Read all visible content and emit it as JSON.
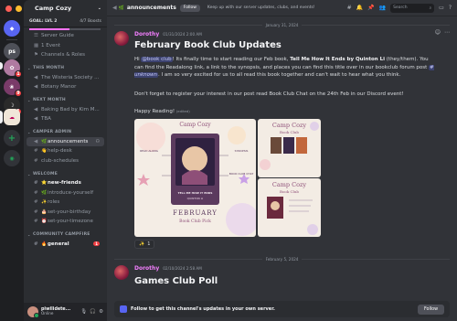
{
  "server": {
    "name": "Camp Cozy",
    "boost_level": "GOAL: LVL 2",
    "boost_count": "4/7 Boosts",
    "boost_progress": 0.57
  },
  "sidebar": {
    "top_items": [
      {
        "icon": "☰",
        "label": "Server Guide"
      },
      {
        "icon": "▦",
        "label": "1 Event"
      },
      {
        "icon": "⚑",
        "label": "Channels & Roles"
      }
    ],
    "categories": [
      {
        "title": "THIS MONTH",
        "channels": [
          {
            "icon": "🔈",
            "label": "The Wisteria Society ..."
          },
          {
            "icon": "🔈",
            "label": "Botany Manor"
          }
        ]
      },
      {
        "title": "NEXT MONTH",
        "channels": [
          {
            "icon": "🔈",
            "label": "Baking Bad by Kim M..."
          },
          {
            "icon": "🔈",
            "label": "TBA"
          }
        ]
      },
      {
        "title": "CAMPER ADMIN",
        "channels": [
          {
            "icon": "📢",
            "emoji": "🌿",
            "label": "announcements",
            "active": true
          },
          {
            "icon": "#",
            "emoji": "👋",
            "label": "help-desk"
          },
          {
            "icon": "#",
            "label": "club-schedules"
          }
        ]
      },
      {
        "title": "WELCOME",
        "channels": [
          {
            "icon": "#",
            "emoji": "⭐",
            "label": "new-friends",
            "unread": true
          },
          {
            "icon": "#",
            "emoji": "🌿",
            "label": "introduce-yourself"
          },
          {
            "icon": "#",
            "emoji": "✨",
            "label": "roles"
          },
          {
            "icon": "#",
            "emoji": "🎂",
            "label": "set-your-birthday"
          },
          {
            "icon": "#",
            "emoji": "⏰",
            "label": "set-your-timezone"
          }
        ]
      },
      {
        "title": "COMMUNITY CAMPFIRE",
        "channels": [
          {
            "icon": "#",
            "emoji": "🔥",
            "label": "general",
            "unread": true,
            "mention": "1"
          }
        ]
      }
    ],
    "user": {
      "name": "piwilidete...",
      "status": "Online"
    }
  },
  "header": {
    "channel": "announcements",
    "follow": "Follow",
    "topic": "Keep up with our server updates, clubs, and events!",
    "search_placeholder": "Search"
  },
  "messages": [
    {
      "date": "January 31, 2024",
      "author": "Dorothy",
      "timestamp": "01/31/2024 2:00 AM",
      "title": "February Book Club Updates",
      "p1_pre": "Hi ",
      "p1_mention": "@book club",
      "p1_mid": "! Its finally time to start reading our Feb book, ",
      "p1_book": "Tell Me How It Ends by Quinton Li",
      "p1_post": " (they/them). You can find the Readalong link, a link to the synopsis, and places you can find this title over in our bookclub forum post ",
      "p1_channel": "# unknown",
      "p1_end": ". I am so very excited for us to all read this book together and can't wait to hear what you think.",
      "p2": "Don't forget to register your interest in our post read Book Club Chat on the 24th Feb in our Discord event!",
      "p3": "Happy Reading!",
      "edited": "(edited)",
      "reaction_emoji": "✨",
      "reaction_count": "1",
      "images": {
        "main_header": "Camp Cozy",
        "month": "FEBRUARY",
        "sub": "Book Club Pick",
        "book_title": "TELL ME HOW IT ENDS",
        "book_author": "QUINTON LI",
        "readalong": "READ ALONG",
        "synopsis": "SYNOPSIS",
        "chat": "BOOK CLUB CHAT",
        "side1_title": "Camp Cozy",
        "side1_sub": "Book Club",
        "side2_title": "Camp Cozy",
        "side2_sub": "Book Club"
      }
    },
    {
      "date": "February 5, 2024",
      "author": "Dorothy",
      "timestamp": "02/10/2024 2:58 AM",
      "title": "Games Club Poll"
    }
  ],
  "follow_banner": {
    "text": "Follow to get this channel's updates in your own server.",
    "button": "Follow"
  },
  "colors": {
    "author": "#f47fff",
    "accent": "#5865f2",
    "mention_bg": "#3c4270"
  }
}
